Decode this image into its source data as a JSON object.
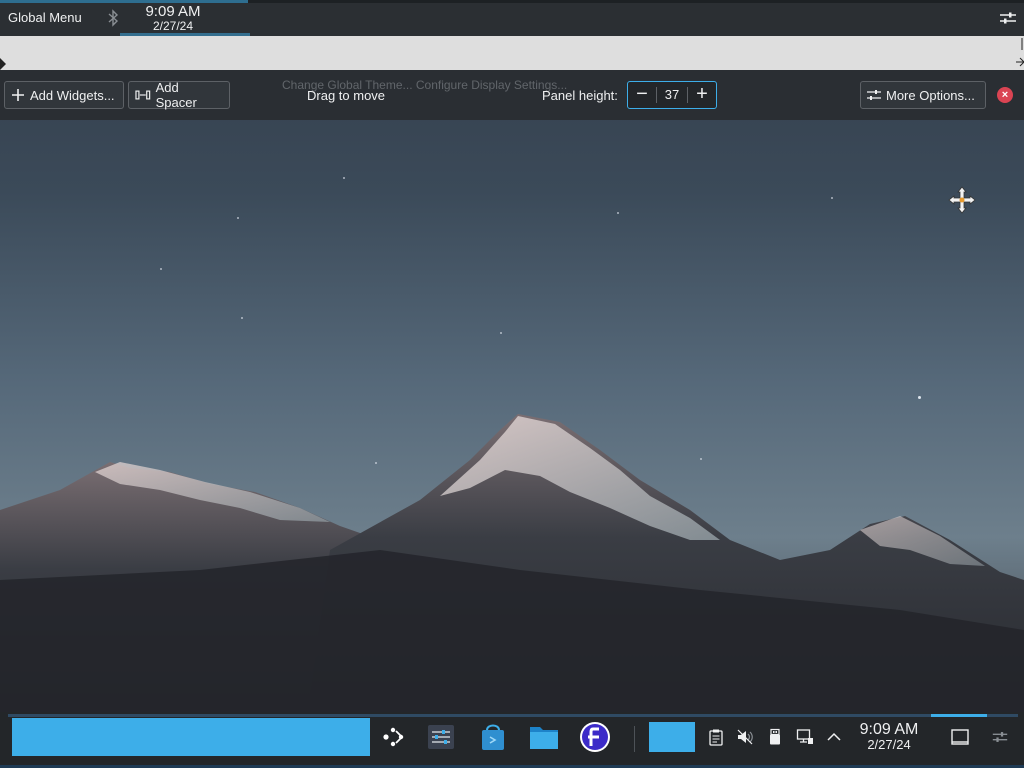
{
  "top_panel": {
    "global_menu_label": "Global Menu",
    "clock_time": "9:09 AM",
    "clock_date": "2/27/24"
  },
  "edit_toolbar": {
    "add_widgets_label": "Add Widgets...",
    "add_spacer_label": "Add Spacer",
    "ghost_text": "Change Global Theme...   Configure Display Settings...",
    "drag_to_move_label": "Drag to move",
    "panel_height_label": "Panel height:",
    "panel_height_value": "37",
    "spin_minus": "−",
    "spin_plus": "+",
    "more_options_label": "More Options..."
  },
  "bottom_panel": {
    "clock_time": "9:09 AM",
    "clock_date": "2/27/24",
    "task_icons": [
      "app-launcher-icon",
      "system-settings-icon",
      "discover-store-icon",
      "file-manager-icon",
      "fedora-icon"
    ],
    "tray_icons": [
      "clipboard-icon",
      "volume-muted-icon",
      "usb-device-icon",
      "network-wired-icon",
      "expand-tray-icon"
    ]
  },
  "colors": {
    "accent": "#3daee9",
    "panel_bg": "#232629",
    "close": "#da4453"
  }
}
